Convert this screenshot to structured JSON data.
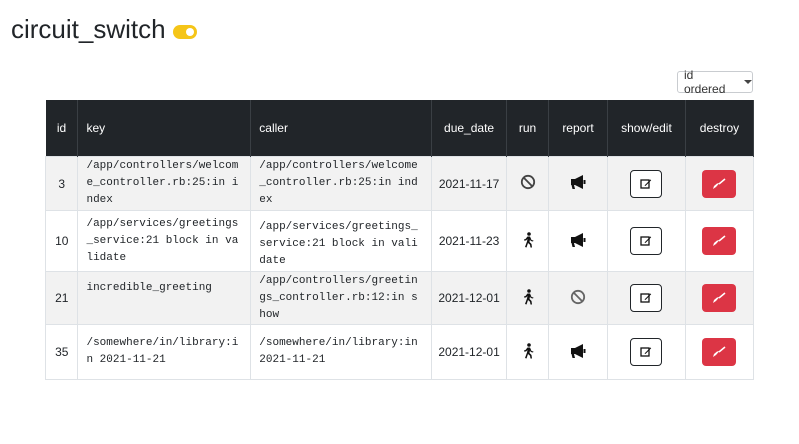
{
  "title": "circuit_switch",
  "order_select": {
    "value": "id ordered"
  },
  "table": {
    "headers": [
      "id",
      "key",
      "caller",
      "due_date",
      "run",
      "report",
      "show/edit",
      "destroy"
    ],
    "rows": [
      {
        "id": "3",
        "key": "/app/controllers/welcome_controller.rb:25:in index",
        "caller": "/app/controllers/welcome_controller.rb:25:in index",
        "due_date": "2021-11-17",
        "run": "ban-icon",
        "report": "megaphone-icon"
      },
      {
        "id": "10",
        "key": "/app/services/greetings_service:21 block in validate",
        "caller": "/app/services/greetings_service:21 block in validate",
        "due_date": "2021-11-23",
        "run": "walking-person-icon",
        "report": "megaphone-icon"
      },
      {
        "id": "21",
        "key": "incredible_greeting",
        "caller": "/app/controllers/greetings_controller.rb:12:in show",
        "due_date": "2021-12-01",
        "run": "walking-person-icon",
        "report": "ban-icon"
      },
      {
        "id": "35",
        "key": "/somewhere/in/library:in 2021-11-21",
        "caller": "/somewhere/in/library:in 2021-11-21",
        "due_date": "2021-12-01",
        "run": "walking-person-icon",
        "report": "megaphone-icon"
      }
    ]
  },
  "colors": {
    "header_bg": "#212529",
    "toggle": "#f5c518",
    "destroy": "#dc3545"
  }
}
